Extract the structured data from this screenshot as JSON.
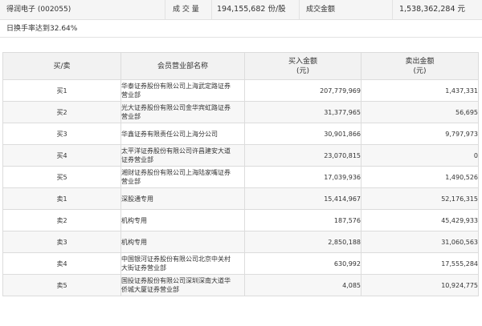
{
  "summary": {
    "stock": "得润电子 (002055)",
    "volume_label": "成 交 量",
    "volume_value": "194,155,682 份/股",
    "amount_label": "成交金额",
    "amount_value": "1,538,362,284 元"
  },
  "note": "日换手率达到32.64%",
  "table": {
    "headers": {
      "direction": "买/卖",
      "member": "会员营业部名称",
      "buy": "买入金额\n(元)",
      "sell": "卖出金额\n(元)"
    },
    "rows": [
      {
        "dir": "买1",
        "name": "华泰证券股份有限公司上海武定路证券营业部",
        "buy": "207,779,969",
        "sell": "1,437,331"
      },
      {
        "dir": "买2",
        "name": "光大证券股份有限公司金华宾虹路证券营业部",
        "buy": "31,377,965",
        "sell": "56,695"
      },
      {
        "dir": "买3",
        "name": "华鑫证券有限责任公司上海分公司",
        "buy": "30,901,866",
        "sell": "9,797,973"
      },
      {
        "dir": "买4",
        "name": "太平洋证券股份有限公司许昌建安大道证券营业部",
        "buy": "23,070,815",
        "sell": "0"
      },
      {
        "dir": "买5",
        "name": "湘财证券股份有限公司上海陆家嘴证券营业部",
        "buy": "17,039,936",
        "sell": "1,490,526"
      },
      {
        "dir": "卖1",
        "name": "深股通专用",
        "buy": "15,414,967",
        "sell": "52,176,315"
      },
      {
        "dir": "卖2",
        "name": "机构专用",
        "buy": "187,576",
        "sell": "45,429,933"
      },
      {
        "dir": "卖3",
        "name": "机构专用",
        "buy": "2,850,188",
        "sell": "31,060,563"
      },
      {
        "dir": "卖4",
        "name": "中国银河证券股份有限公司北京中关村大街证券营业部",
        "buy": "630,992",
        "sell": "17,555,284"
      },
      {
        "dir": "卖5",
        "name": "国投证券股份有限公司深圳深南大道华侨城大厦证券营业部",
        "buy": "4,085",
        "sell": "10,924,775"
      }
    ]
  }
}
